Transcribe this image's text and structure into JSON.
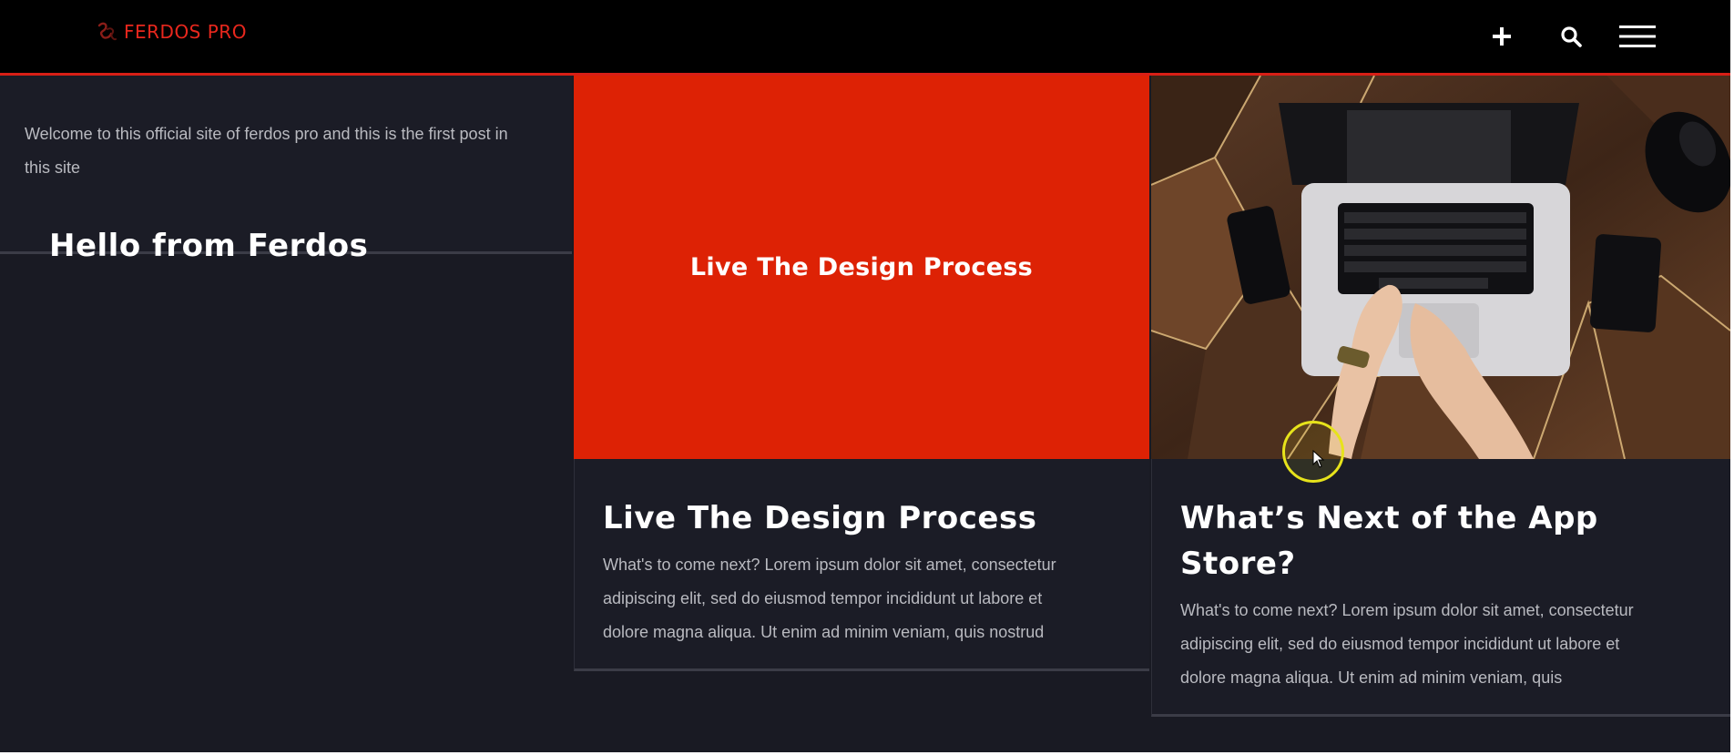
{
  "header": {
    "logo_text": "FERDOS PRO",
    "icons": [
      "plus-icon",
      "search-icon",
      "hamburger-menu-icon"
    ]
  },
  "colors": {
    "accent": "#e8271d",
    "hero_red": "#dd2205",
    "background": "#191a23",
    "header_bg": "#000000"
  },
  "posts": [
    {
      "title": "Hello from Ferdos",
      "excerpt_lines": [
        "Welcome to this official site of ferdos pro and this is the first post in",
        "this site"
      ]
    },
    {
      "hero_text": "Live The Design Process",
      "title": "Live The Design Process",
      "excerpt_lines": [
        "What's to come next? Lorem ipsum dolor sit amet, consectetur",
        "adipiscing elit, sed do eiusmod tempor incididunt ut labore et",
        "dolore magna aliqua. Ut enim ad minim veniam, quis nostrud"
      ]
    },
    {
      "image": "laptop-desk-photo",
      "title_lines": [
        "What’s Next of the App",
        "Store?"
      ],
      "excerpt_lines": [
        "What's to come next? Lorem ipsum dolor sit amet, consectetur",
        "adipiscing elit, sed do eiusmod tempor incididunt ut labore et",
        "dolore magna aliqua. Ut enim ad minim veniam, quis"
      ]
    }
  ]
}
